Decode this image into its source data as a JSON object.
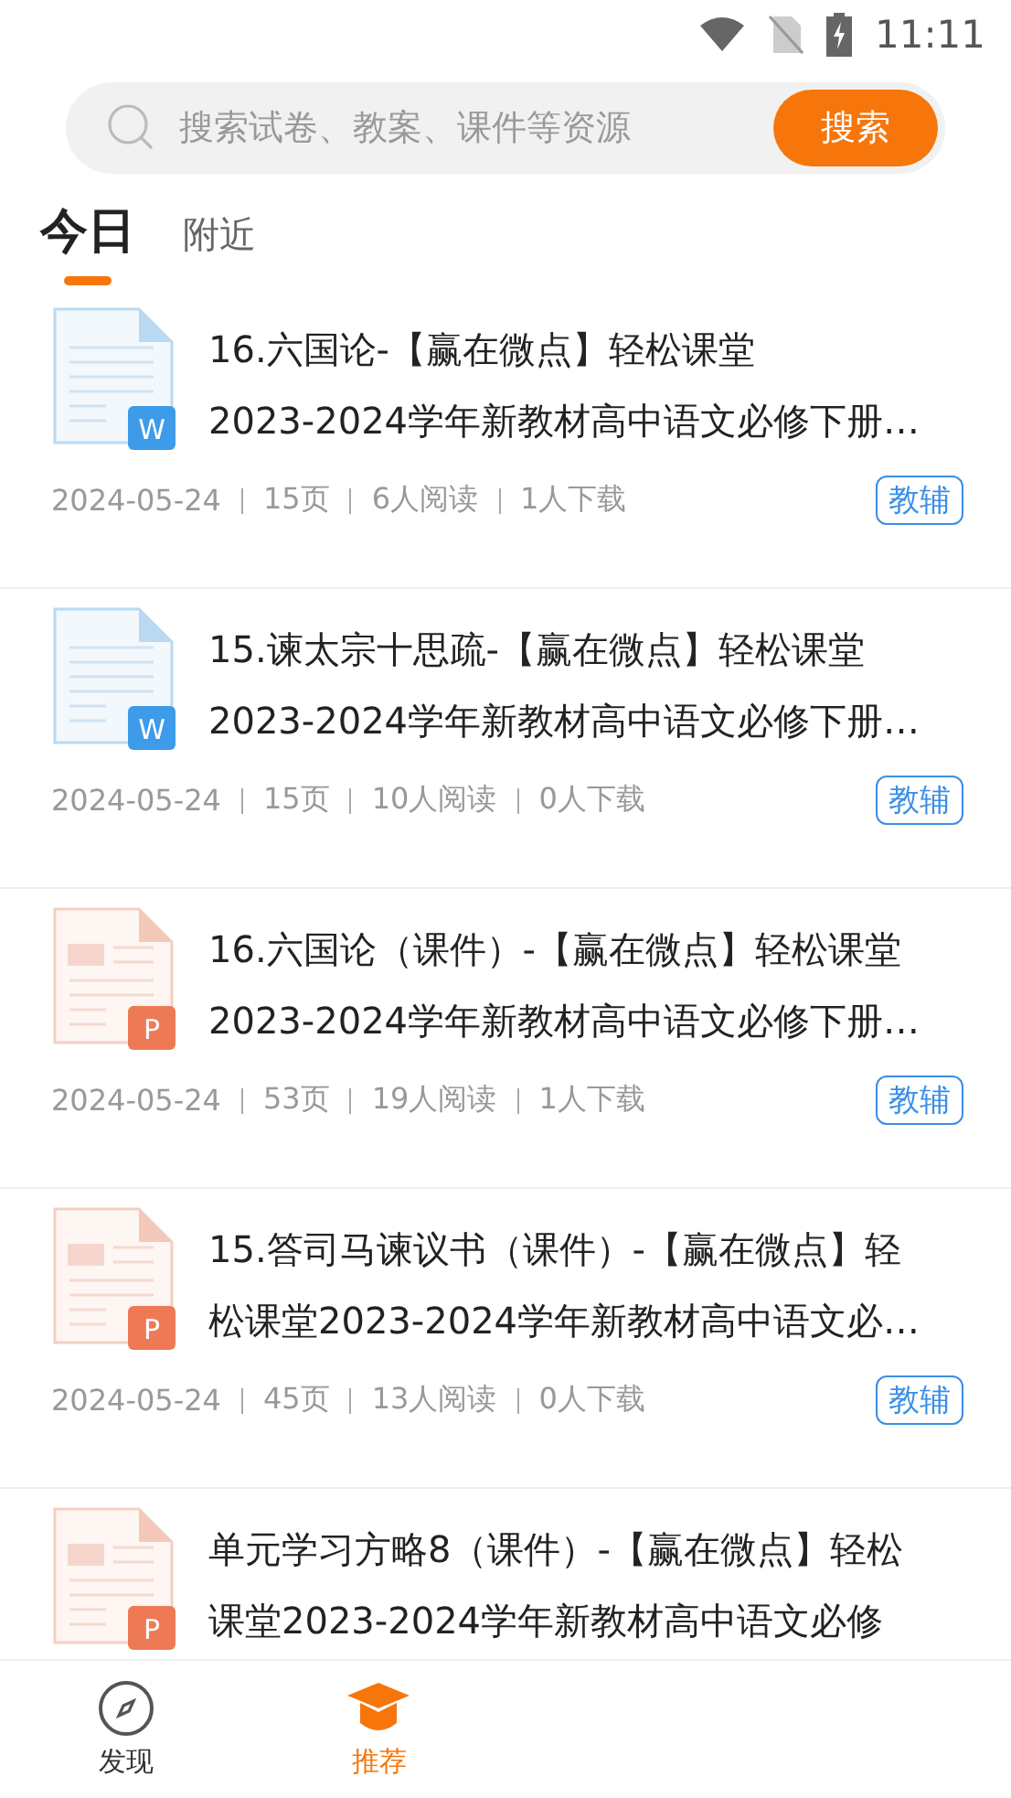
{
  "status_bar": {
    "time": "11:11"
  },
  "search": {
    "placeholder": "搜索试卷、教案、课件等资源",
    "button": "搜索"
  },
  "tabs": [
    {
      "label": "今日",
      "selected": true
    },
    {
      "label": "附近",
      "selected": false
    }
  ],
  "documents": [
    {
      "kind": "word",
      "badge": "W",
      "title_lines": [
        "16.六国论-【赢在微点】轻松课堂",
        "2023-2024学年新教材高中语文必修下册…"
      ],
      "date": "2024-05-24",
      "pages": "15页",
      "reads": "6人阅读",
      "downloads": "1人下载",
      "tag": "教辅"
    },
    {
      "kind": "word",
      "badge": "W",
      "title_lines": [
        "15.谏太宗十思疏-【赢在微点】轻松课堂",
        "2023-2024学年新教材高中语文必修下册…"
      ],
      "date": "2024-05-24",
      "pages": "15页",
      "reads": "10人阅读",
      "downloads": "0人下载",
      "tag": "教辅"
    },
    {
      "kind": "ppt",
      "badge": "P",
      "title_lines": [
        "16.六国论（课件）-【赢在微点】轻松课堂",
        "2023-2024学年新教材高中语文必修下册…"
      ],
      "date": "2024-05-24",
      "pages": "53页",
      "reads": "19人阅读",
      "downloads": "1人下载",
      "tag": "教辅"
    },
    {
      "kind": "ppt",
      "badge": "P",
      "title_lines": [
        "15.答司马谏议书（课件）-【赢在微点】轻",
        "松课堂2023-2024学年新教材高中语文必…"
      ],
      "date": "2024-05-24",
      "pages": "45页",
      "reads": "13人阅读",
      "downloads": "0人下载",
      "tag": "教辅"
    },
    {
      "kind": "ppt",
      "badge": "P",
      "title_lines": [
        "单元学习方略8（课件）-【赢在微点】轻松",
        "课堂2023-2024学年新教材高中语文必修"
      ]
    }
  ],
  "bottom_nav": [
    {
      "label": "发现",
      "selected": false
    },
    {
      "label": "推荐",
      "selected": true
    }
  ]
}
